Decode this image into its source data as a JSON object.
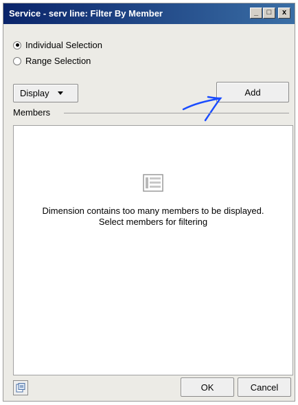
{
  "window": {
    "title": "Service - serv line: Filter By Member",
    "controls": {
      "minimize": "_",
      "maximize": "□",
      "close": "x"
    }
  },
  "selection_mode": {
    "options": [
      {
        "label": "Individual Selection",
        "selected": true
      },
      {
        "label": "Range Selection",
        "selected": false
      }
    ]
  },
  "toolbar": {
    "display_label": "Display",
    "add_label": "Add"
  },
  "members": {
    "group_label": "Members",
    "empty_message_line1": "Dimension contains too many members to be displayed.",
    "empty_message_line2": "Select members for filtering"
  },
  "footer": {
    "ok_label": "OK",
    "cancel_label": "Cancel"
  },
  "colors": {
    "titlebar_start": "#0a246a",
    "titlebar_end": "#3a6ea5",
    "annotation": "#1a4cff",
    "dialog_background": "#ecebe6"
  }
}
